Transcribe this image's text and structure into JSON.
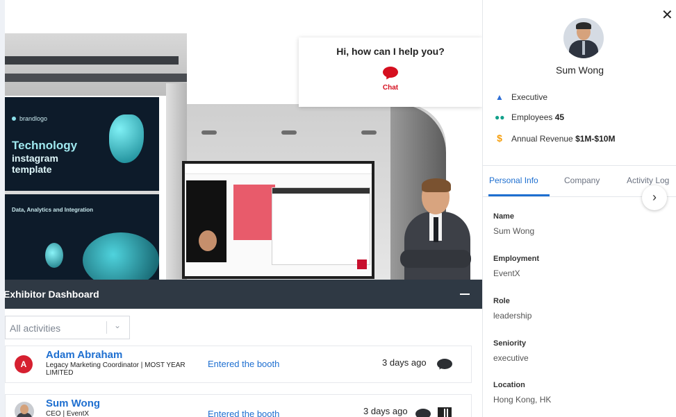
{
  "booth": {
    "poster_brand": "brandlogo",
    "poster_title_1": "Technology",
    "poster_title_2": "instagram",
    "poster_title_3": "template",
    "poster_subtitle": "Data, Analytics and Integration"
  },
  "help_card": {
    "title": "Hi, how can I help you?",
    "chat_label": "Chat",
    "accent_color": "#d50f1f"
  },
  "dashboard": {
    "title": "Exhibitor Dashboard",
    "minimize_icon": "minus-icon",
    "filter": {
      "value": "All activities"
    },
    "rows": [
      {
        "avatar_initial": "A",
        "name": "Adam Abraham",
        "subtitle": "Legacy Marketing Coordinator | MOST YEAR LIMITED",
        "action": "Entered the booth",
        "time": "3 days ago"
      },
      {
        "avatar_initial": "",
        "name": "Sum Wong",
        "subtitle": "CEO | EventX",
        "action": "Entered the booth",
        "time": "3 days ago"
      }
    ]
  },
  "profile": {
    "name": "Sum Wong",
    "stats": {
      "level": "Executive",
      "employees_label": "Employees",
      "employees_value": "45",
      "revenue_label": "Annual Revenue",
      "revenue_value": "$1M-$10M"
    },
    "tabs": [
      "Personal Info",
      "Company",
      "Activity Log"
    ],
    "active_tab": "Personal Info",
    "fields": [
      {
        "label": "Name",
        "value": "Sum Wong"
      },
      {
        "label": "Employment",
        "value": "EventX"
      },
      {
        "label": "Role",
        "value": "leadership"
      },
      {
        "label": "Seniority",
        "value": "executive"
      },
      {
        "label": "Location",
        "value": "Hong Kong, HK"
      }
    ],
    "colors": {
      "accent": "#1e6fd0",
      "employees_icon": "#12a08a",
      "revenue_icon": "#f59e0b",
      "executive_icon": "#2f6fd6"
    }
  }
}
